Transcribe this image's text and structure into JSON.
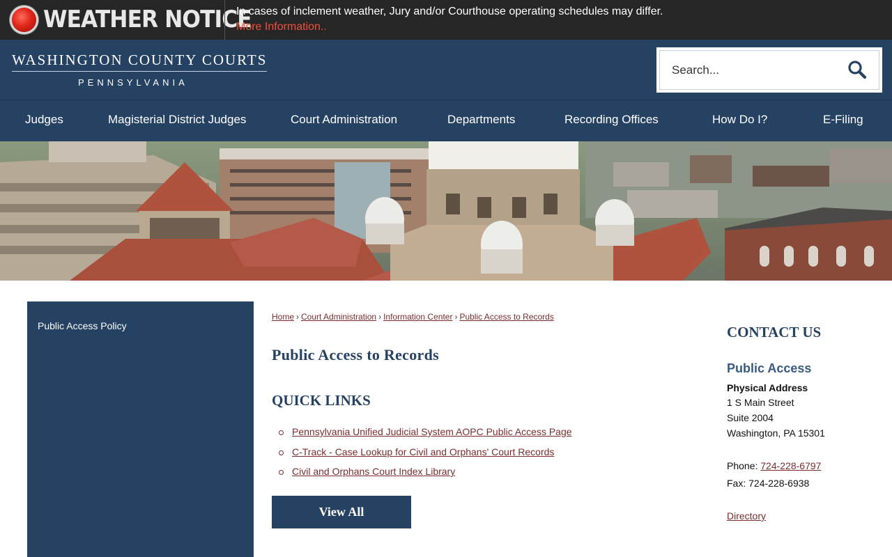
{
  "notice": {
    "title": "WEATHER NOTICE",
    "message": "In cases of inclement weather, Jury and/or Courthouse operating schedules may differ.",
    "link": "More Information.."
  },
  "header": {
    "logo_line1": "WASHINGTON COUNTY COURTS",
    "logo_line2": "PENNSYLVANIA",
    "search_placeholder": "Search..."
  },
  "nav": {
    "items": [
      {
        "label": "Judges"
      },
      {
        "label": "Magisterial District Judges"
      },
      {
        "label": "Court Administration"
      },
      {
        "label": "Departments"
      },
      {
        "label": "Recording Offices"
      },
      {
        "label": "How Do I?"
      },
      {
        "label": "E-Filing"
      }
    ]
  },
  "sidebar": {
    "items": [
      {
        "label": "Public Access Policy"
      }
    ]
  },
  "breadcrumb": [
    "Home",
    "Court Administration",
    "Information Center",
    "Public Access to Records"
  ],
  "main": {
    "title": "Public Access to Records",
    "quick_links_title": "QUICK LINKS",
    "links": [
      "Pennsylvania Unified Judicial System AOPC Public Access Page",
      "C-Track - Case Lookup for Civil and Orphans' Court Records",
      "Civil and Orphans Court Index Library"
    ],
    "view_all": "View All"
  },
  "contact": {
    "title": "CONTACT US",
    "subtitle": "Public Access",
    "address_label": "Physical Address",
    "address_line1": "1 S Main Street",
    "address_line2": "Suite 2004",
    "address_line3": "Washington, PA 15301",
    "phone_label": "Phone:",
    "phone": "724-228-6797",
    "fax": "Fax: 724-228-6938",
    "directory": "Directory"
  },
  "colors": {
    "brand_navy": "#264262",
    "notice_bg": "#262626",
    "link": "#7a2d2d",
    "notice_link": "#f0503c"
  }
}
